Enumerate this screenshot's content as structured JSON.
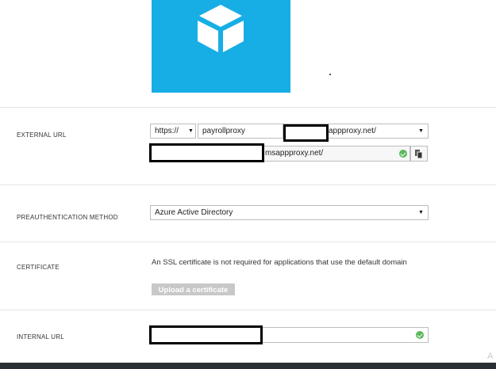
{
  "external_url": {
    "label": "EXTERNAL URL",
    "scheme": "https://",
    "app_name": "payrollproxy",
    "domain_suffix": "sappproxy.net/",
    "full_url_suffix": "msappproxy.net/"
  },
  "preauth": {
    "label": "PREAUTHENTICATION METHOD",
    "value": "Azure Active Directory"
  },
  "certificate": {
    "label": "CERTIFICATE",
    "message": "An SSL certificate is not required for applications that use the default domain",
    "upload_label": "Upload a certificate"
  },
  "internal_url": {
    "label": "INTERNAL URL"
  },
  "corner_glyph": "A",
  "colors": {
    "tile": "#16aee5",
    "check": "#5cb85c",
    "footer": "#2b3036"
  }
}
